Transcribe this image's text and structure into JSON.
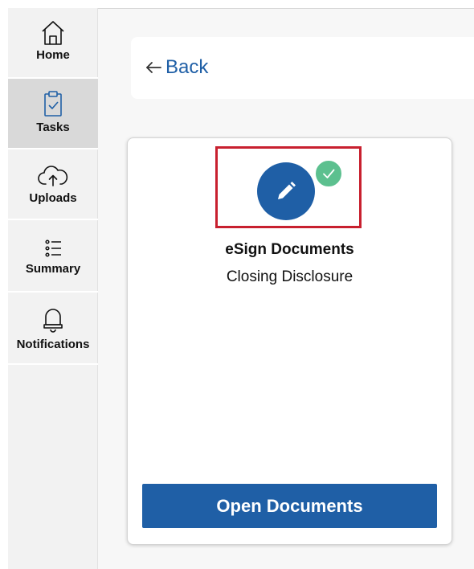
{
  "sidebar": {
    "items": [
      {
        "label": "Home",
        "icon": "home-icon",
        "active": false
      },
      {
        "label": "Tasks",
        "icon": "clipboard-check-icon",
        "active": true
      },
      {
        "label": "Uploads",
        "icon": "cloud-upload-icon",
        "active": false
      },
      {
        "label": "Summary",
        "icon": "list-icon",
        "active": false
      },
      {
        "label": "Notifications",
        "icon": "bell-icon",
        "active": false
      }
    ]
  },
  "header": {
    "back_label": "Back",
    "back_icon": "arrow-left-icon"
  },
  "task_card": {
    "title": "eSign Documents",
    "subtitle": "Closing Disclosure",
    "icon": "pencil-icon",
    "status_icon": "check-icon",
    "status": "completed",
    "button_label": "Open Documents"
  },
  "colors": {
    "accent": "#1f5fa6",
    "success": "#5cc08f",
    "highlight": "#c8202f",
    "active_nav": "#d9d9d9"
  }
}
